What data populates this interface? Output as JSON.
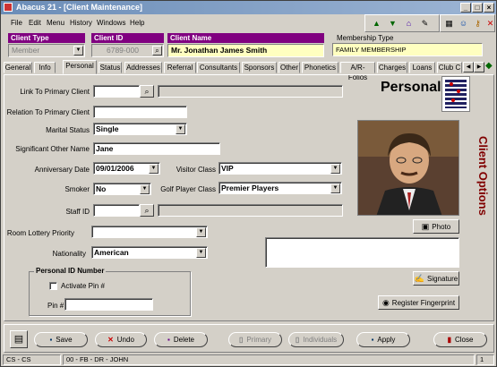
{
  "window": {
    "title": "Abacus 21 - [Client Maintenance]"
  },
  "menu": [
    "File",
    "Edit",
    "Menu",
    "History",
    "Windows",
    "Help"
  ],
  "header": {
    "client_type_label": "Client Type",
    "client_type_value": "Member",
    "client_id_label": "Client ID",
    "client_id_value": "6789-000",
    "client_name_label": "Client Name",
    "client_name_value": "Mr. Jonathan James Smith",
    "membership_type_label": "Membership Type",
    "membership_type_value": "FAMILY MEMBERSHIP"
  },
  "tabs": [
    "General",
    "Info",
    "Personal",
    "Status",
    "Addresses",
    "Referral",
    "Consultants",
    "Sponsors",
    "Other",
    "Phonetics",
    "A/R-Folios",
    "Charges",
    "Loans",
    "Club C"
  ],
  "active_tab": "Personal",
  "personal": {
    "heading": "Personal",
    "side_label": "Client Options",
    "link_primary_label": "Link To Primary Client",
    "link_primary_value": "",
    "relation_label": "Relation To Primary Client",
    "relation_value": "",
    "marital_label": "Marital Status",
    "marital_value": "Single",
    "sig_other_label": "Significant Other Name",
    "sig_other_value": "Jane",
    "anniversary_label": "Anniversary Date",
    "anniversary_value": "09/01/2006",
    "visitor_class_label": "Visitor Class",
    "visitor_class_value": "VIP",
    "smoker_label": "Smoker",
    "smoker_value": "No",
    "golf_class_label": "Golf Player Class",
    "golf_class_value": "Premier Players",
    "staff_id_label": "Staff ID",
    "staff_id_value": "",
    "room_lottery_label": "Room Lottery Priority",
    "room_lottery_value": "",
    "nationality_label": "Nationality",
    "nationality_value": "American",
    "pid_group_label": "Personal ID Number",
    "activate_pin_label": "Activate Pin #",
    "activate_pin_checked": false,
    "pin_label": "Pin #",
    "pin_value": "",
    "photo_button": "Photo",
    "signature_button": "Signature",
    "fingerprint_button": "Register Fingerprint"
  },
  "actions": {
    "save": "Save",
    "undo": "Undo",
    "delete": "Delete",
    "primary": "Primary",
    "individuals": "Individuals",
    "apply": "Apply",
    "close": "Close"
  },
  "status": {
    "cell1": "CS - CS",
    "cell2": "00 - FB - DR - JOHN",
    "page": "1"
  },
  "colors": {
    "header_label": "#800080",
    "client_options_text": "#800000",
    "titlebar": "#6b8db8"
  }
}
